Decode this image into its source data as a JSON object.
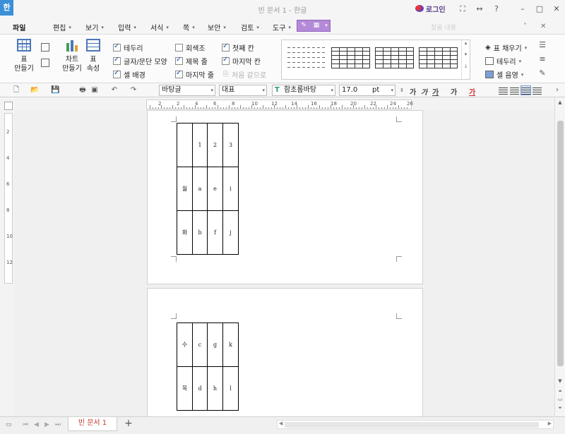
{
  "window": {
    "title": "빈 문서 1 - 한글",
    "app_icon": "한",
    "login": "로그인"
  },
  "menu": {
    "file": "파일",
    "items": [
      "편집",
      "보기",
      "입력",
      "서식",
      "쪽",
      "보안",
      "검토",
      "도구"
    ],
    "search_placeholder": "찾을 내용"
  },
  "ribbon": {
    "table_create": [
      "표",
      "만들기"
    ],
    "chart_create": [
      "차트",
      "만들기"
    ],
    "table_props": [
      "표",
      "속성"
    ],
    "options_col1": [
      {
        "label": "테두리",
        "checked": true
      },
      {
        "label": "글자/문단 모양",
        "checked": true
      },
      {
        "label": "셀 배경",
        "checked": true
      }
    ],
    "options_col2": [
      {
        "label": "회색조",
        "checked": false
      },
      {
        "label": "제목 줄",
        "checked": true
      },
      {
        "label": "마지막 줄",
        "checked": true
      }
    ],
    "options_col3": [
      {
        "label": "첫째 칸",
        "checked": true
      },
      {
        "label": "마지막 칸",
        "checked": true
      },
      {
        "label": "처음 같으로",
        "checked": false,
        "disabled": true
      }
    ],
    "right_tools": [
      "표 채우기",
      "테두리",
      "셀 음영"
    ]
  },
  "format_bar": {
    "style": "바탕글",
    "para_style": "대표",
    "font": "함초롬바탕",
    "font_size": "17.0",
    "size_unit": "pt",
    "text_buttons": [
      "가",
      "가",
      "가",
      "가",
      "가"
    ]
  },
  "ruler": {
    "h_numbers": [
      "2",
      "2",
      "4",
      "6",
      "8",
      "10",
      "12",
      "14",
      "16",
      "18",
      "20",
      "22",
      "24",
      "26"
    ],
    "v_numbers": [
      "2",
      "4",
      "6",
      "8",
      "10",
      "12"
    ]
  },
  "table_page1": [
    [
      "",
      "1",
      "2",
      "3"
    ],
    [
      "월",
      "a",
      "e",
      "i"
    ],
    [
      "화",
      "b",
      "f",
      "j"
    ]
  ],
  "table_page2": [
    [
      "수",
      "c",
      "g",
      "k"
    ],
    [
      "목",
      "d",
      "h",
      "l"
    ]
  ],
  "tabs": {
    "document": "빈 문서 1",
    "add": "+"
  }
}
